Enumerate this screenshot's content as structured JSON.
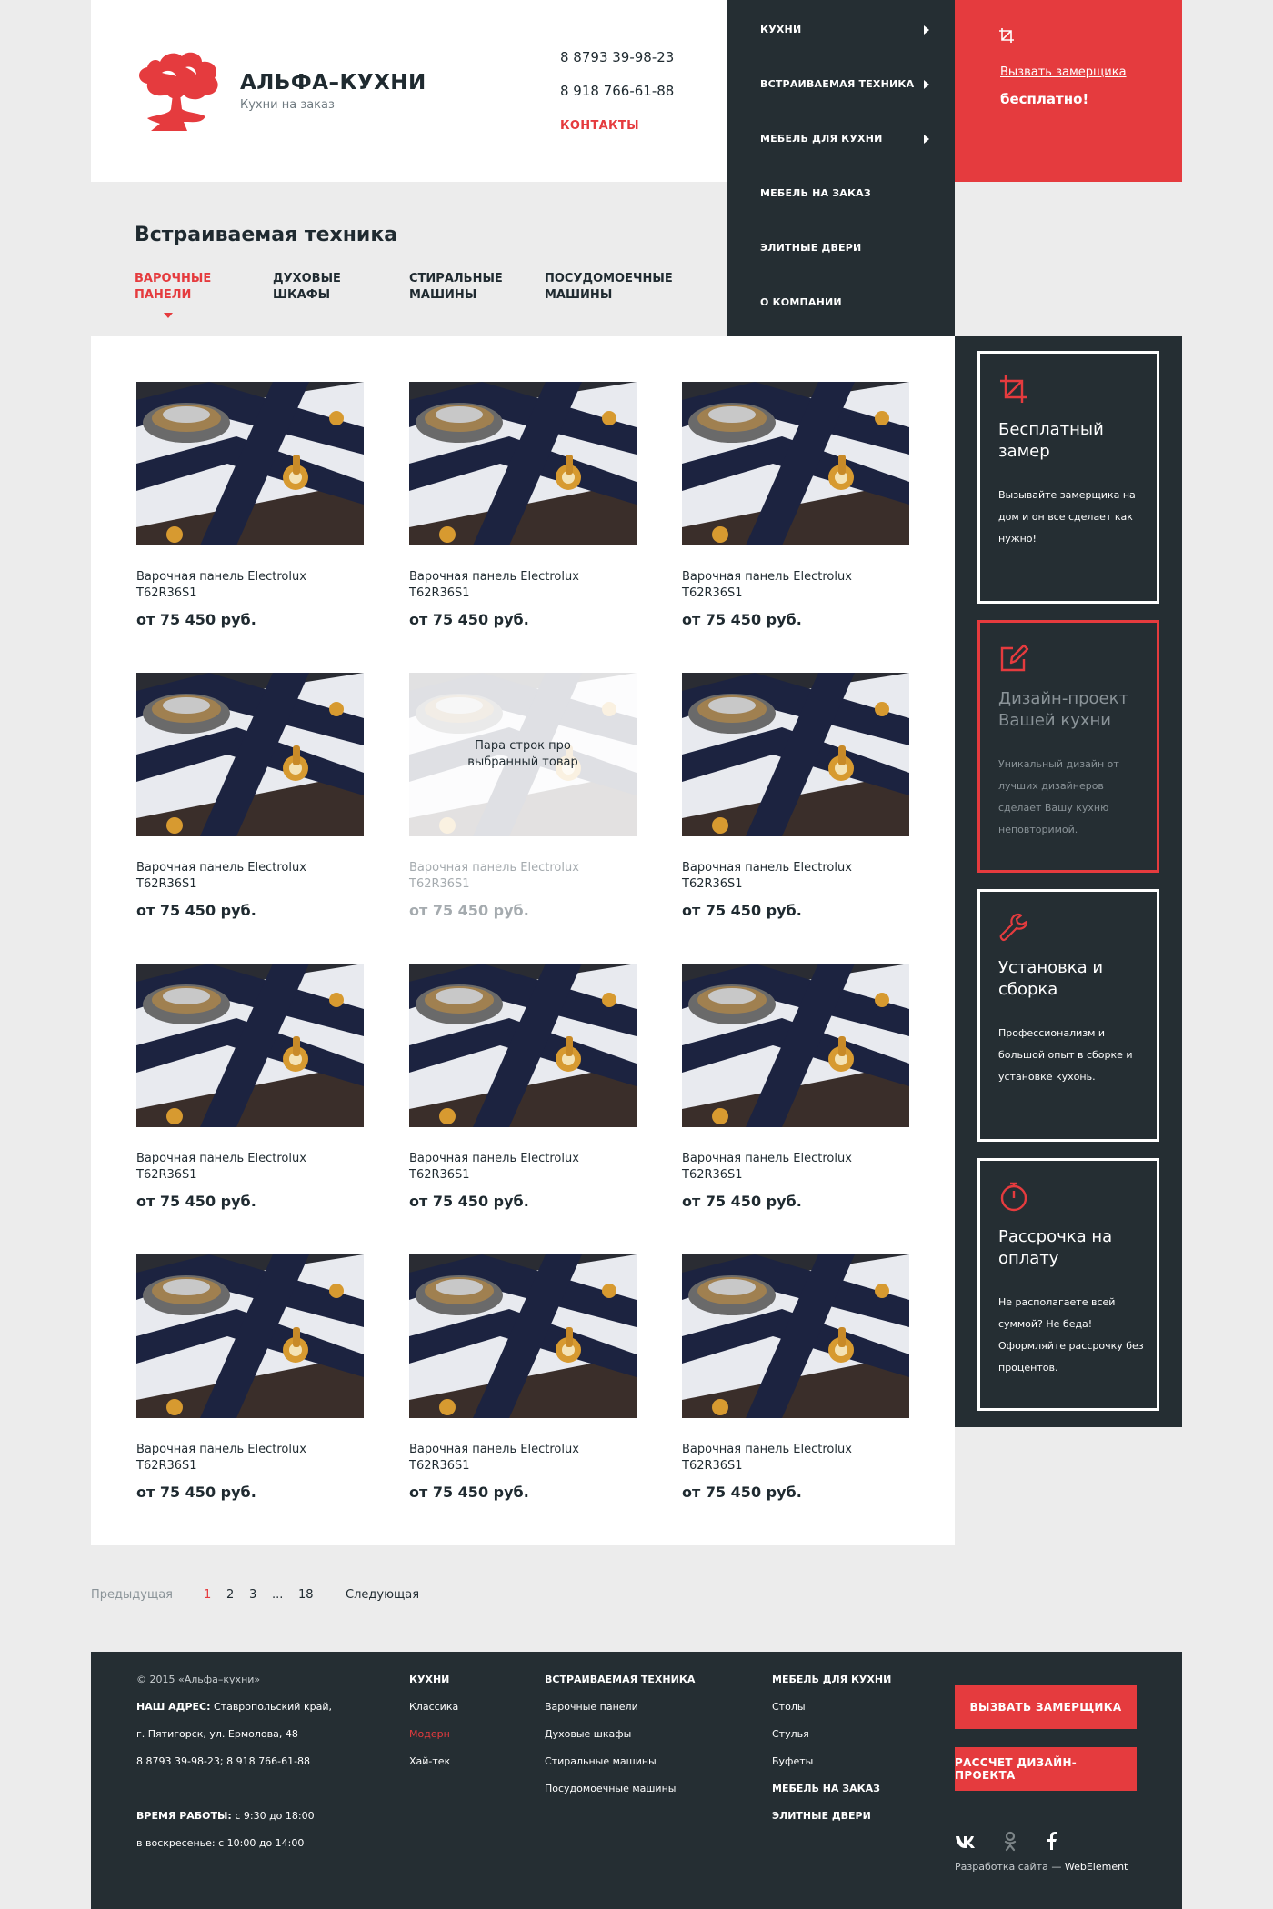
{
  "header": {
    "brand": "АЛЬФА–КУХНИ",
    "tagline": "Кухни на заказ",
    "phone1": "8 8793 39-98-23",
    "phone2": "8 918 766-61-88",
    "contacts": "КОНТАКТЫ",
    "logo_icon": "tree-logo-icon"
  },
  "nav": {
    "items": [
      {
        "label": "КУХНИ",
        "has_submenu": true
      },
      {
        "label": "ВСТРАИВАЕМАЯ ТЕХНИКА",
        "has_submenu": true
      },
      {
        "label": "МЕБЕЛЬ ДЛЯ КУХНИ",
        "has_submenu": true
      },
      {
        "label": "МЕБЕЛЬ НА ЗАКАЗ",
        "has_submenu": false
      },
      {
        "label": "ЭЛИТНЫЕ ДВЕРИ",
        "has_submenu": false
      },
      {
        "label": "О КОМПАНИИ",
        "has_submenu": false
      }
    ]
  },
  "callbox": {
    "link": "Вызвать замерщика",
    "free": "бесплатно!",
    "icon": "crop-icon"
  },
  "section": {
    "title": "Встраиваемая техника",
    "subnav": [
      {
        "line1": "ВАРОЧНЫЕ",
        "line2": "ПАНЕЛИ",
        "active": true
      },
      {
        "line1": "ДУХОВЫЕ",
        "line2": "ШКАФЫ",
        "active": false
      },
      {
        "line1": "СТИРАЛЬНЫЕ",
        "line2": "МАШИНЫ",
        "active": false
      },
      {
        "line1": "ПОСУДОМОЕЧНЫЕ",
        "line2": "МАШИНЫ",
        "active": false
      }
    ]
  },
  "products": {
    "name_line1": "Варочная панель Electrolux",
    "name_line2": "T62R36S1",
    "price": "от 75 450 руб.",
    "hover_text": "Пара строк про выбранный товар",
    "hover_index": 4,
    "count": 12
  },
  "sidebar": {
    "features": [
      {
        "icon": "crop-icon",
        "title": "Бесплатный замер",
        "text": "Вызывайте замерщика на дом и он все сделает как нужно!",
        "highlight": false
      },
      {
        "icon": "edit-icon",
        "title": "Дизайн-проект Вашей кухни",
        "text": "Уникальный дизайн от лучших дизайнеров сделает Вашу кухню неповторимой.",
        "highlight": true
      },
      {
        "icon": "wrench-icon",
        "title": "Установка и сборка",
        "text": "Профессионализм и большой опыт в сборке и установке кухонь.",
        "highlight": false
      },
      {
        "icon": "stopwatch-icon",
        "title": "Рассрочка на оплату",
        "text": "Не располагаете всей суммой? Не беда! Оформляйте рассрочку без процентов.",
        "highlight": false
      }
    ]
  },
  "pagination": {
    "prev": "Предыдущая",
    "pages": [
      "1",
      "2",
      "3",
      "...",
      "18"
    ],
    "current": "1",
    "next": "Следующая"
  },
  "footer": {
    "copyright": "© 2015   «Альфа–кухни»",
    "address_label": "НАШ АДРЕС:",
    "address_line1": "Ставропольский край,",
    "address_line2": "г. Пятигорск, ул. Ермолова, 48",
    "phones": "8 8793 39-98-23; 8 918 766-61-88",
    "hours_label": "ВРЕМЯ РАБОТЫ:",
    "hours": "с 9:30 до 18:00",
    "sunday": "в воскресенье: с 10:00 до 14:00",
    "col_kitchens": {
      "title": "КУХНИ",
      "items": [
        "Классика",
        "Модерн",
        "Хай-тек"
      ],
      "active": "Модерн"
    },
    "col_tech": {
      "title": "ВСТРАИВАЕМАЯ ТЕХНИКА",
      "items": [
        "Варочные панели",
        "Духовые шкафы",
        "Стиральные машины",
        "Посудомоечные машины"
      ]
    },
    "col_furniture": {
      "title": "МЕБЕЛЬ ДЛЯ КУХНИ",
      "items": [
        "Столы",
        "Стулья",
        "Буфеты"
      ],
      "extra1": "МЕБЕЛЬ НА ЗАКАЗ",
      "extra2": "ЭЛИТНЫЕ ДВЕРИ"
    },
    "btn_measure": "ВЫЗВАТЬ ЗАМЕРЩИКА",
    "btn_design": "РАССЧЕТ ДИЗАЙН-ПРОЕКТА",
    "social": [
      "vk-icon",
      "odnoklassniki-icon",
      "facebook-icon"
    ],
    "dev_prefix": "Разработка сайта —",
    "dev_name": "WebElement"
  },
  "colors": {
    "accent": "#e53b3e",
    "dark": "#252e33",
    "background": "#ececec"
  }
}
